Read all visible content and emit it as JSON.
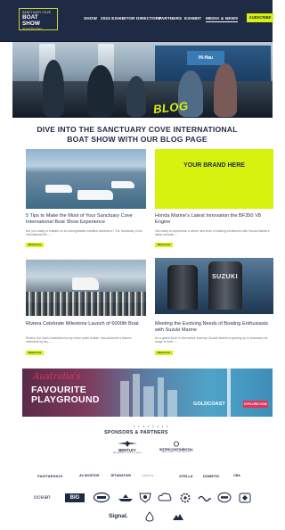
{
  "logo": {
    "line1": "SANCTUARY COVE",
    "line2": "BOAT SHOW",
    "line3": "20-23 MAY 2021"
  },
  "nav": {
    "items": [
      {
        "label": "SHOW"
      },
      {
        "label": "2024 EXHIBITOR DIRECTORY"
      },
      {
        "label": "PARTNERS"
      },
      {
        "label": "EXHIBIT"
      },
      {
        "label": "MEDIA & NEWS"
      }
    ],
    "active_index": 4,
    "subscribe_label": "SUBSCRIBE"
  },
  "hero": {
    "overlay_text": "BLOG",
    "sign_text": "Hi-Hau"
  },
  "main_heading": "DIVE INTO THE SANCTUARY COVE INTERNATIONAL BOAT SHOW WITH OUR BLOG PAGE",
  "posts": [
    {
      "title": "5 Tips to Make the Most of Your Sanctuary Cove International Boat Show Experience",
      "excerpt": "Are you ready to embark on an unforgettable maritime adventure? The Sanctuary Cove International Bo......",
      "read_more": "Read more"
    },
    {
      "title": "Honda Marine's Latest Innovation the BF350 V8 Engine",
      "excerpt": "Get ready to experience a whole new level of boating excitement with Honda Marine's latest innovati......",
      "read_more": "Read more",
      "image_text": "YOUR BRAND HERE"
    },
    {
      "title": "Riviera Celebrate Milestone Launch of 6000th Boat",
      "excerpt": "Riviera, the iconic Australian luxury motor yacht builder, has achieved a historic milestone by lau......",
      "read_more": "Read more"
    },
    {
      "title": "Meeting the Evolving Needs of Boating Enthusiasts with Suzuki Marine",
      "excerpt": "As a global force in the marine industry, Suzuki Marine is gearing up to showcase its range of outb......",
      "read_more": "Read more",
      "image_text": "SUZUKI"
    }
  ],
  "banner": {
    "script_text": "Australia's",
    "title_line1": "FAVOURITE",
    "title_line2": "PLAYGROUND",
    "logo_text": "GOLDCOAST",
    "cta_label": "EXPLORE NOW"
  },
  "carousel_dots": "• • • • • • • •",
  "sponsors": {
    "heading": "SPONSORS & PARTNERS",
    "row1": [
      {
        "name": "BENTLEY",
        "sub": "BRISBANE & GOLD COAST"
      },
      {
        "name": "INTERCONTINENTAL",
        "sub": "SANCTUARY COVE RESORT"
      }
    ],
    "row2": [
      "PANTAENIUS",
      "AV AVIATION",
      "JETAVIATION",
      "• • • • • •",
      "STELLA",
      "DOMETIC",
      "CBA"
    ],
    "row3": [
      "ocean",
      "BIG",
      "",
      "",
      "",
      "",
      "",
      "",
      "",
      ""
    ],
    "row4": [
      "Signal.",
      "",
      ""
    ]
  },
  "colors": {
    "navy": "#1f2a44",
    "lime": "#d8f20f",
    "accent_pink": "#e3335a"
  },
  "icons": [
    "subscribe-button-arrow-icon",
    "sponsor-logo-icon"
  ]
}
